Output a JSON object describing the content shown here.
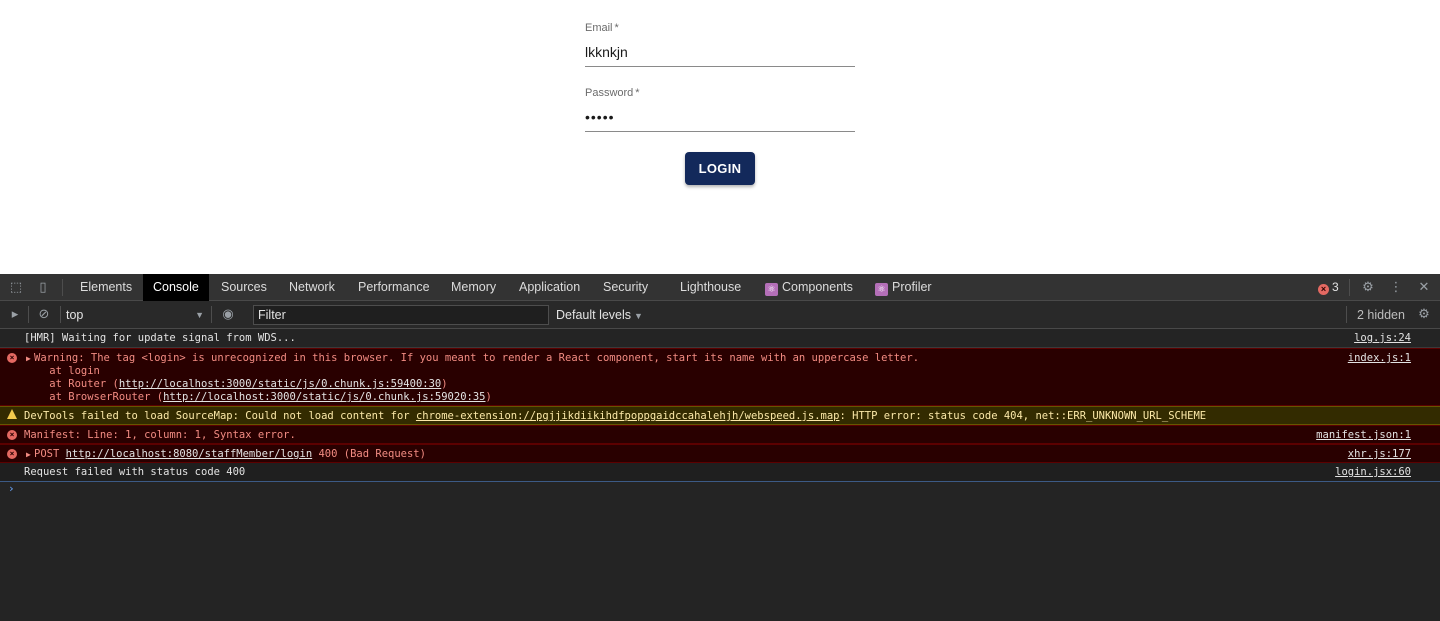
{
  "login": {
    "email_label": "Email",
    "email_required": "*",
    "email_value": "lkknkjn",
    "password_label": "Password",
    "password_required": "*",
    "password_value": "•••••",
    "button_label": "LOGIN",
    "button_color": "#13295b"
  },
  "devtools": {
    "tabs": {
      "elements": "Elements",
      "console": "Console",
      "sources": "Sources",
      "network": "Network",
      "performance": "Performance",
      "memory": "Memory",
      "application": "Application",
      "security": "Security",
      "lighthouse": "Lighthouse",
      "components": "Components",
      "profiler": "Profiler"
    },
    "active_tab": "Console",
    "error_count": "3",
    "toolbar": {
      "context": "top",
      "filter_placeholder": "Filter",
      "levels": "Default levels",
      "hidden": "2 hidden"
    },
    "messages": [
      {
        "type": "info",
        "text": "[HMR] Waiting for update signal from WDS...",
        "source": "log.js:24"
      },
      {
        "type": "error",
        "text": "Warning: The tag <login> is unrecognized in this browser. If you meant to render a React component, start its name with an uppercase letter.",
        "stack1": "    at login",
        "stack2_prefix": "    at Router (",
        "stack2_link": "http://localhost:3000/static/js/0.chunk.js:59400:30",
        "stack2_suffix": ")",
        "stack3_prefix": "    at BrowserRouter (",
        "stack3_link": "http://localhost:3000/static/js/0.chunk.js:59020:35",
        "stack3_suffix": ")",
        "source": "index.js:1"
      },
      {
        "type": "warning",
        "prefix": "DevTools failed to load SourceMap: Could not load content for ",
        "link": "chrome-extension://pgjjikdiikihdfpoppgaidccahalehjh/webspeed.js.map",
        "suffix": ": HTTP error: status code 404, net::ERR_UNKNOWN_URL_SCHEME"
      },
      {
        "type": "error",
        "text": "Manifest: Line: 1, column: 1, Syntax error.",
        "source": "manifest.json:1"
      },
      {
        "type": "error",
        "prefix": "POST ",
        "link": "http://localhost:8080/staffMember/login",
        "suffix": " 400 (Bad Request)",
        "source": "xhr.js:177"
      },
      {
        "type": "info",
        "text": "Request failed with status code 400",
        "source": "login.jsx:60"
      }
    ],
    "prompt": "›"
  }
}
